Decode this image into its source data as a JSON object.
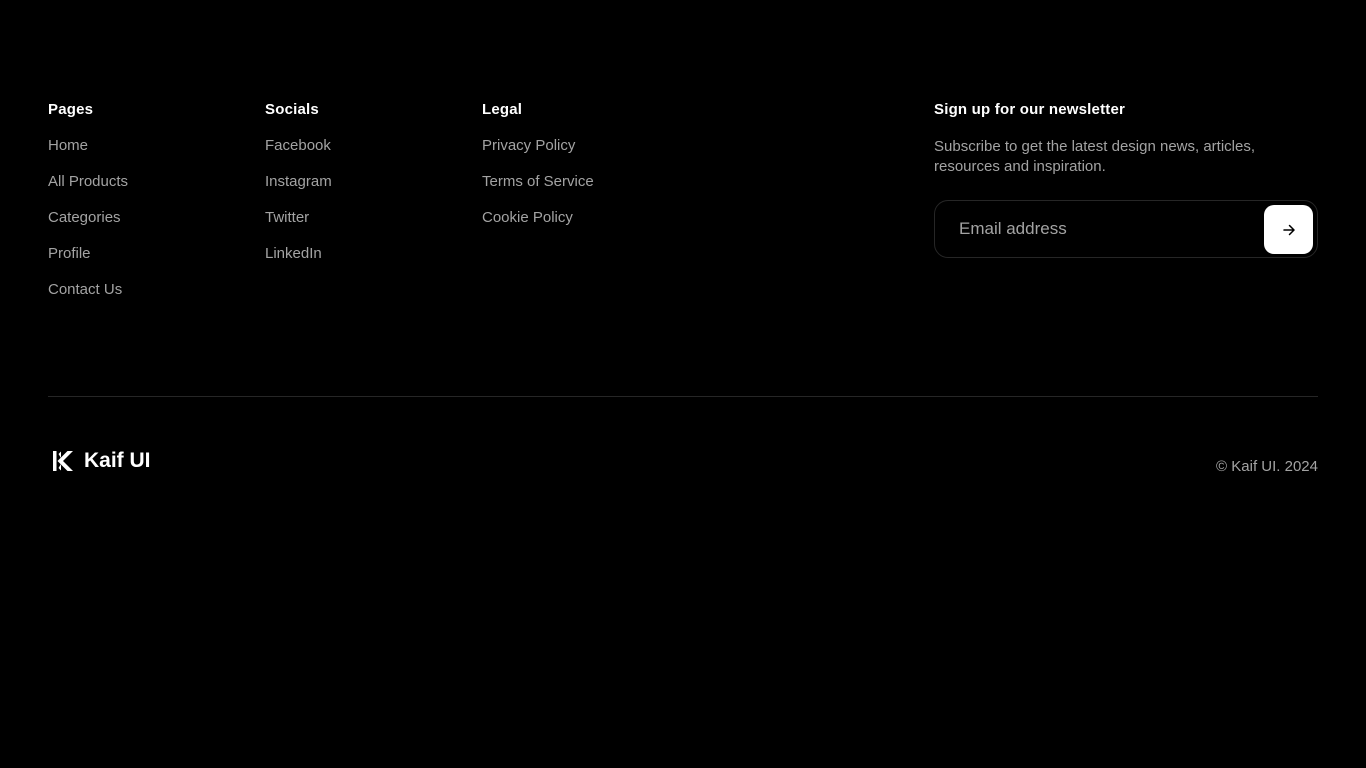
{
  "columns": {
    "pages": {
      "title": "Pages",
      "links": [
        "Home",
        "All Products",
        "Categories",
        "Profile",
        "Contact Us"
      ]
    },
    "socials": {
      "title": "Socials",
      "links": [
        "Facebook",
        "Instagram",
        "Twitter",
        "LinkedIn"
      ]
    },
    "legal": {
      "title": "Legal",
      "links": [
        "Privacy Policy",
        "Terms of Service",
        "Cookie Policy"
      ]
    }
  },
  "newsletter": {
    "title": "Sign up for our newsletter",
    "description": "Subscribe to get the latest design news, articles, resources and inspiration.",
    "email_placeholder": "Email address",
    "email_value": "",
    "submit_icon": "arrow-right-icon"
  },
  "brand": {
    "name": "Kaif UI",
    "logo_icon": "kaif-k-logo-icon"
  },
  "copyright": "© Kaif UI. 2024",
  "colors": {
    "background": "#000000",
    "heading": "#ffffff",
    "link": "#a3a3a3",
    "border": "#262626",
    "button": "#ffffff"
  }
}
